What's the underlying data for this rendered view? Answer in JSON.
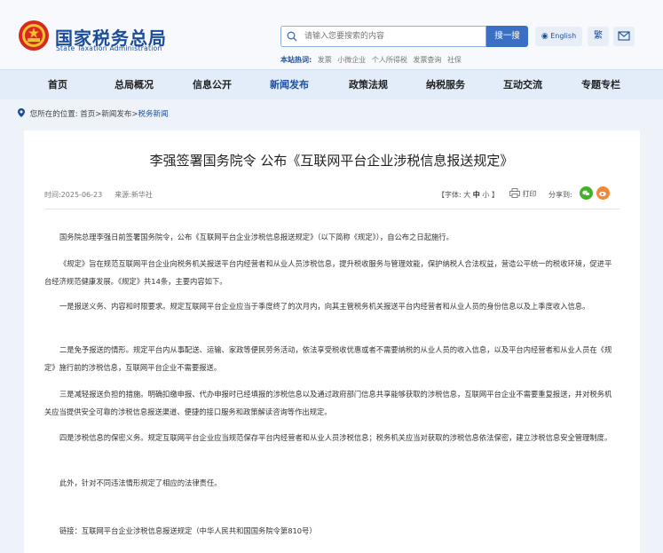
{
  "header": {
    "logo_cn": "国家税务总局",
    "logo_en": "State Taxation Administration",
    "search_placeholder": "请输入您要搜索的内容",
    "search_button": "搜一搜",
    "lang_button": "English",
    "trad_button": "繁",
    "hot_label": "本站热词:",
    "hot_words": [
      "发票",
      "小微企业",
      "个人所得税",
      "发票查询",
      "社保"
    ]
  },
  "nav": {
    "items": [
      "首页",
      "总局概况",
      "信息公开",
      "新闻发布",
      "政策法规",
      "纳税服务",
      "互动交流",
      "专题专栏"
    ],
    "active_index": 3
  },
  "breadcrumb": {
    "prefix": "您所在的位置:",
    "path": "首页>新闻发布>",
    "current": "税务新闻"
  },
  "article": {
    "title": "李强签署国务院令 公布《互联网平台企业涉税信息报送规定》",
    "time": "时间:2025-06-23",
    "source": "来源:新华社",
    "font_label": "【字体:",
    "font_large": "大",
    "font_medium": "中",
    "font_small": "小",
    "font_end": "】",
    "print": "打印",
    "share": "分享到:",
    "paragraphs": [
      "国务院总理李强日前签署国务院令，公布《互联网平台企业涉税信息报送规定》（以下简称《规定》），自公布之日起施行。",
      "《规定》旨在规范互联网平台企业向税务机关报送平台内经营者和从业人员涉税信息，提升税收服务与管理效能，保护纳税人合法权益，营造公平统一的税收环境，促进平台经济规范健康发展。《规定》共14条，主要内容如下。",
      "一是报送义务、内容和时限要求。规定互联网平台企业应当于季度终了的次月内，向其主管税务机关报送平台内经营者和从业人员的身份信息以及上季度收入信息。",
      "二是免予报送的情形。规定平台内从事配送、运输、家政等便民劳务活动，依法享受税收优惠或者不需要纳税的从业人员的收入信息，以及平台内经营者和从业人员在《规定》施行前的涉税信息，互联网平台企业不需要报送。",
      "三是减轻报送负担的措施。明确扣缴申报、代办申报时已经填报的涉税信息以及通过政府部门信息共享能够获取的涉税信息，互联网平台企业不需要重复报送，并对税务机关应当提供安全可靠的涉税信息报送渠道、便捷的接口服务和政策解读咨询等作出规定。",
      "四是涉税信息的保密义务。规定互联网平台企业应当规范保存平台内经营者和从业人员涉税信息；税务机关应当对获取的涉税信息依法保密，建立涉税信息安全管理制度。",
      "此外，针对不同违法情形规定了相应的法律责任。"
    ],
    "link_text": "链接：互联网平台企业涉税信息报送规定（中华人民共和国国务院令第810号）"
  },
  "colors": {
    "brand": "#1b4d9c",
    "nav_bg": "#e3ecf9",
    "search_button": "#3b6fc4"
  }
}
